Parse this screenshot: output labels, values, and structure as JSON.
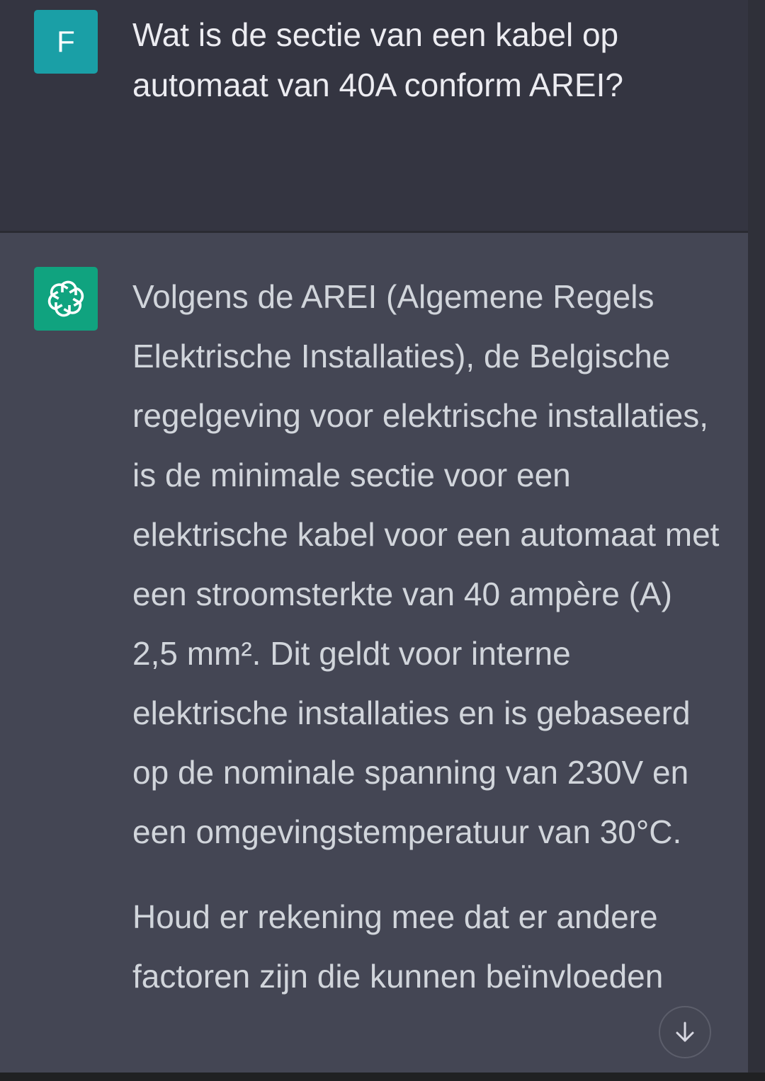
{
  "user_message": {
    "avatar_initial": "F",
    "text": "Wat is de sectie van een kabel op automaat van 40A conform AREI?"
  },
  "assistant_message": {
    "avatar_icon": "openai-logo-icon",
    "paragraphs": [
      "Volgens de AREI (Algemene Regels Elektrische Installaties), de Belgische regelgeving voor elektrische installaties, is de minimale sectie voor een elektrische kabel voor een automaat met een stroomsterkte van 40 ampère (A) 2,5 mm². Dit geldt voor interne elektrische installaties en is gebaseerd op de nominale spanning van 230V en een omgevingstemperatuur van 30°C.",
      "Houd er rekening mee dat er andere factoren zijn die kunnen beïnvloeden"
    ]
  },
  "controls": {
    "scroll_down_icon": "arrow-down-icon"
  },
  "colors": {
    "user_bg": "#343541",
    "assistant_bg": "#444654",
    "user_avatar": "#1a9fa6",
    "assistant_avatar": "#10a37f"
  }
}
